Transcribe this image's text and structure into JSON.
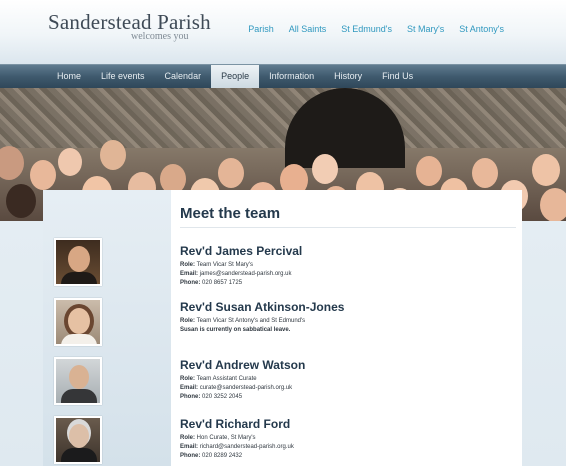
{
  "site": {
    "title": "Sanderstead Parish",
    "tagline": "welcomes you"
  },
  "parish_nav": [
    "Parish",
    "All Saints",
    "St Edmund's",
    "St Mary's",
    "St Antony's"
  ],
  "main_nav": {
    "items": [
      "Home",
      "Life events",
      "Calendar",
      "People",
      "Information",
      "History",
      "Find Us"
    ],
    "active": "People"
  },
  "page": {
    "title": "Meet the team"
  },
  "people": [
    {
      "name": "Rev'd James Percival",
      "role_label": "Role:",
      "role": "Team Vicar St Mary's",
      "email_label": "Email:",
      "email": "james@sanderstead-parish.org.uk",
      "phone_label": "Phone:",
      "phone": "020 8657 1725"
    },
    {
      "name": "Rev'd Susan Atkinson-Jones",
      "role_label": "Role:",
      "role": "Team Vicar St Antony's and St Edmund's",
      "note": "Susan is currently on sabbatical leave."
    },
    {
      "name": "Rev'd Andrew Watson",
      "role_label": "Role:",
      "role": "Team Assistant Curate",
      "email_label": "Email:",
      "email": "curate@sanderstead-parish.org.uk",
      "phone_label": "Phone:",
      "phone": "020 3252 2045"
    },
    {
      "name": "Rev'd Richard Ford",
      "role_label": "Role:",
      "role": "Hon Curate, St Mary's",
      "email_label": "Email:",
      "email": "richard@sanderstead-parish.org.uk",
      "phone_label": "Phone:",
      "phone": "020 8289 2432"
    }
  ],
  "colors": {
    "accent_link": "#2f98bf",
    "nav_bar": "#3f5a6e",
    "heading": "#24394c"
  }
}
